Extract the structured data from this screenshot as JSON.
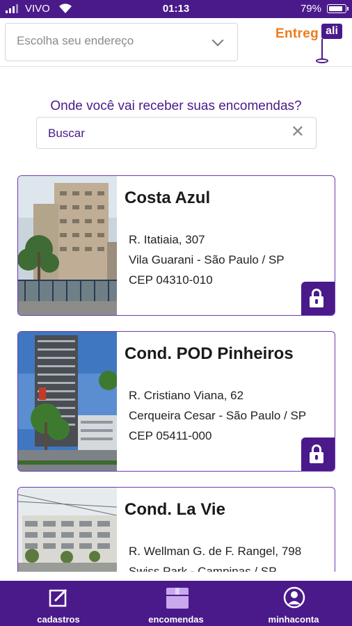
{
  "status_bar": {
    "carrier": "VIVO",
    "time": "01:13",
    "battery": "79%"
  },
  "header": {
    "address_placeholder": "Escolha seu endereço",
    "logo_text": "Entreg",
    "logo_flag": "ali"
  },
  "main": {
    "question": "Onde você vai receber suas encomendas?",
    "search_value": "Buscar"
  },
  "cards": [
    {
      "name": "Costa Azul",
      "address": "R. Itatiaia, 307",
      "district": "Vila Guarani - São Paulo / SP",
      "cep": "CEP 04310-010"
    },
    {
      "name": "Cond. POD Pinheiros",
      "address": "R. Cristiano Viana, 62",
      "district": "Cerqueira Cesar - São Paulo / SP",
      "cep": "CEP 05411-000"
    },
    {
      "name": "Cond. La Vie",
      "address": "R. Wellman G. de F. Rangel, 798",
      "district": "Swiss Park - Campinas / SP",
      "cep": ""
    }
  ],
  "tabbar": {
    "tabs": [
      {
        "label": "cadastros"
      },
      {
        "label": "encomendas"
      },
      {
        "label": "minhaconta"
      }
    ]
  },
  "colors": {
    "primary": "#4a1a8a",
    "logo_orange": "#f07a1a",
    "card_border": "#6a3ab0"
  }
}
